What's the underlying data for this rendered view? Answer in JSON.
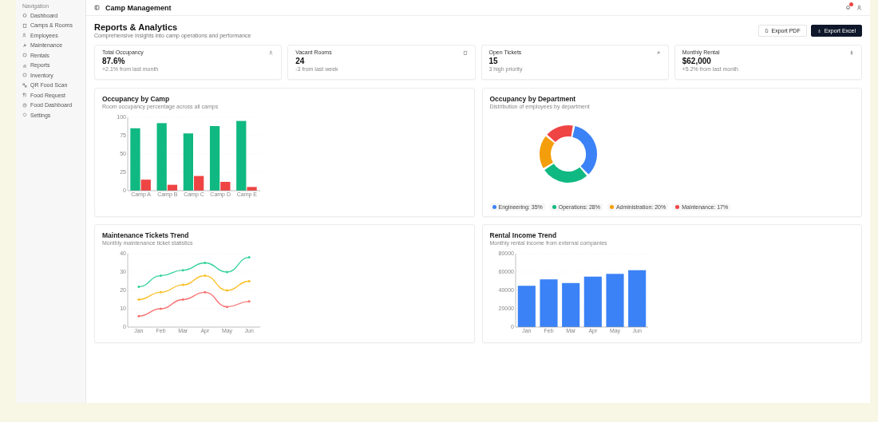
{
  "sidebar": {
    "heading": "Navigation",
    "items": [
      {
        "label": "Dashboard"
      },
      {
        "label": "Camps & Rooms"
      },
      {
        "label": "Employees"
      },
      {
        "label": "Maintenance"
      },
      {
        "label": "Rentals"
      },
      {
        "label": "Reports"
      },
      {
        "label": "Inventory"
      },
      {
        "label": "QR Food Scan"
      },
      {
        "label": "Food Request"
      },
      {
        "label": "Food Dashboard"
      },
      {
        "label": "Settings"
      }
    ]
  },
  "header": {
    "title": "Camp Management"
  },
  "page": {
    "title": "Reports & Analytics",
    "subtitle": "Comprehensive insights into camp operations and performance",
    "buttons": [
      {
        "label": "Export PDF",
        "kind": "outline"
      },
      {
        "label": "Export Excel",
        "kind": "primary"
      }
    ]
  },
  "stats": [
    {
      "label": "Total Occupancy",
      "value": "87.6%",
      "note": "+2.1% from last month"
    },
    {
      "label": "Vacant Rooms",
      "value": "24",
      "note": "-3 from last week"
    },
    {
      "label": "Open Tickets",
      "value": "15",
      "note": "3 high priority"
    },
    {
      "label": "Monthly Rental",
      "value": "$62,000",
      "note": "+5.2% from last month"
    }
  ],
  "charts": [
    {
      "title": "Occupancy by Camp",
      "subtitle": "Room occupancy percentage across all camps",
      "chart_data": {
        "type": "bar",
        "categories": [
          "Camp A",
          "Camp B",
          "Camp C",
          "Camp D",
          "Camp E"
        ],
        "ylim": [
          0,
          100
        ],
        "yticks": [
          0,
          25,
          50,
          75,
          100
        ],
        "series": [
          {
            "color": "#10b981",
            "values": [
              85,
              92,
              78,
              88,
              95
            ]
          },
          {
            "color": "#ef4444",
            "values": [
              15,
              8,
              20,
              12,
              5
            ]
          }
        ]
      }
    },
    {
      "title": "Occupancy by Department",
      "subtitle": "Distribution of employees by department",
      "chart_data": {
        "type": "donut",
        "values": [
          35,
          28,
          20,
          17
        ]
      },
      "legend": [
        {
          "label": "Engineering: 35%",
          "color": "#3b82f6"
        },
        {
          "label": "Operations: 28%",
          "color": "#10b981"
        },
        {
          "label": "Administration: 20%",
          "color": "#f59e0b"
        },
        {
          "label": "Maintenance: 17%",
          "color": "#ef4444"
        }
      ]
    },
    {
      "title": "Maintenance Tickets Trend",
      "subtitle": "Monthly maintenance ticket statistics",
      "chart_data": {
        "type": "line",
        "categories": [
          "Jan",
          "Feb",
          "Mar",
          "Apr",
          "May",
          "Jun"
        ],
        "ylim": [
          0,
          40
        ],
        "yticks": [
          0,
          10,
          20,
          30,
          40
        ],
        "series": [
          {
            "color": "#34d399",
            "values": [
              22,
              28,
              31,
              35,
              30,
              38
            ]
          },
          {
            "color": "#fbbf24",
            "values": [
              15,
              19,
              23,
              28,
              20,
              25
            ]
          },
          {
            "color": "#f87171",
            "values": [
              6,
              10,
              15,
              19,
              11,
              14
            ]
          }
        ]
      }
    },
    {
      "title": "Rental Income Trend",
      "subtitle": "Monthly rental income from external companies",
      "chart_data": {
        "type": "bar",
        "categories": [
          "Jan",
          "Feb",
          "Mar",
          "Apr",
          "May",
          "Jun"
        ],
        "ylim": [
          0,
          80000
        ],
        "yticks": [
          0,
          20000,
          40000,
          60000,
          80000
        ],
        "series": [
          {
            "color": "#3b82f6",
            "values": [
              45000,
              52000,
              48000,
              55000,
              58000,
              62000
            ]
          }
        ]
      }
    }
  ]
}
